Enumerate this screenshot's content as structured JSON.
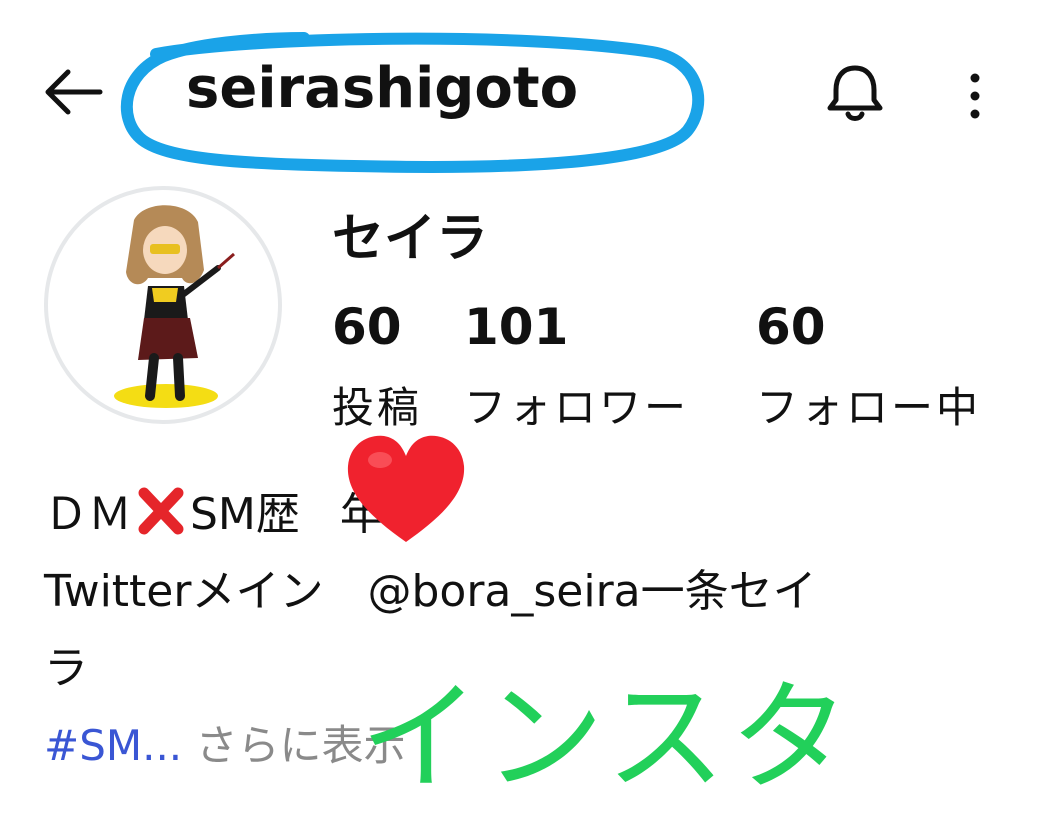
{
  "header": {
    "username": "seirashigoto",
    "back_icon": "arrow-left-icon",
    "bell_icon": "bell-icon",
    "more_icon": "more-vertical-icon"
  },
  "profile": {
    "display_name": "セイラ",
    "avatar": "avatar-illustration",
    "stats": [
      {
        "value": "60",
        "label": "投稿"
      },
      {
        "value": "101",
        "label": "フォロワー"
      },
      {
        "value": "60",
        "label": "フォロー中"
      }
    ]
  },
  "bio": {
    "line1_a": "ＤＭ",
    "line1_b": "SM歴",
    "line1_c": "年",
    "line2": "Twitterメイン　@bora_seira一条セイ",
    "line3": "ラ",
    "hashtag": "#SM...",
    "more": " さらに表示"
  },
  "overlay": {
    "annotation": "インスタ",
    "annotation_color": "#22d05a",
    "circle_color": "#1aa3e8",
    "heart_color": "#f0222e"
  }
}
